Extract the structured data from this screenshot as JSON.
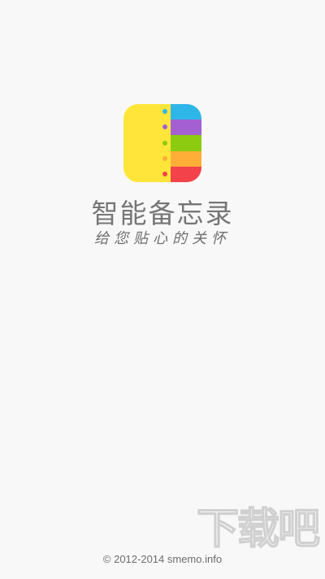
{
  "app": {
    "title": "智能备忘录",
    "slogan": "给您贴心的关怀",
    "copyright": "© 2012-2014 smemo.info",
    "watermark": "下载吧"
  },
  "logo": {
    "icon": "notebook-logo-icon",
    "left_color": "#ffe53a",
    "stripes": [
      "#2fb6e9",
      "#a45fd3",
      "#8ccb10",
      "#ffae37",
      "#f4424a"
    ],
    "dots": [
      "#2fb6e9",
      "#a45fd3",
      "#8ccb10",
      "#ffae37",
      "#f4424a"
    ]
  }
}
